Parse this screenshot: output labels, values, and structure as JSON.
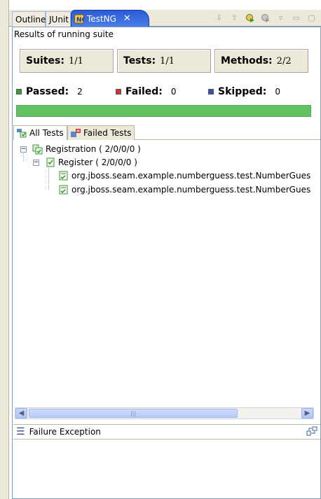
{
  "tabs": [
    {
      "label": "Outline",
      "active": false
    },
    {
      "label": "JUnit",
      "active": false
    },
    {
      "label": "TestNG",
      "active": true
    }
  ],
  "toolbar_icons": [
    "next-failure-icon",
    "previous-failure-icon",
    "rerun-icon",
    "rerun-failed-icon",
    "view-menu-icon",
    "minimize-icon",
    "maximize-icon"
  ],
  "header": {
    "title": "Results of running suite"
  },
  "counters": [
    {
      "label": "Suites:",
      "value": "1/1"
    },
    {
      "label": "Tests:",
      "value": "1/1"
    },
    {
      "label": "Methods:",
      "value": "2/2"
    }
  ],
  "status": [
    {
      "label": "Passed:",
      "value": "2",
      "color": "#3a9a3a"
    },
    {
      "label": "Failed:",
      "value": "0",
      "color": "#cc3333"
    },
    {
      "label": "Skipped:",
      "value": "0",
      "color": "#3355aa"
    }
  ],
  "progress": {
    "fraction": 1.0,
    "color": "#62c262"
  },
  "subtabs": [
    {
      "label": "All Tests",
      "active": true
    },
    {
      "label": "Failed Tests",
      "active": false
    }
  ],
  "tree": {
    "suite": "Registration ( 2/0/0/0 )",
    "test": "Register ( 2/0/0/0 )",
    "methods": [
      "org.jboss.seam.example.numberguess.test.NumberGues",
      "org.jboss.seam.example.numberguess.test.NumberGues"
    ]
  },
  "failure": {
    "title": "Failure Exception"
  }
}
